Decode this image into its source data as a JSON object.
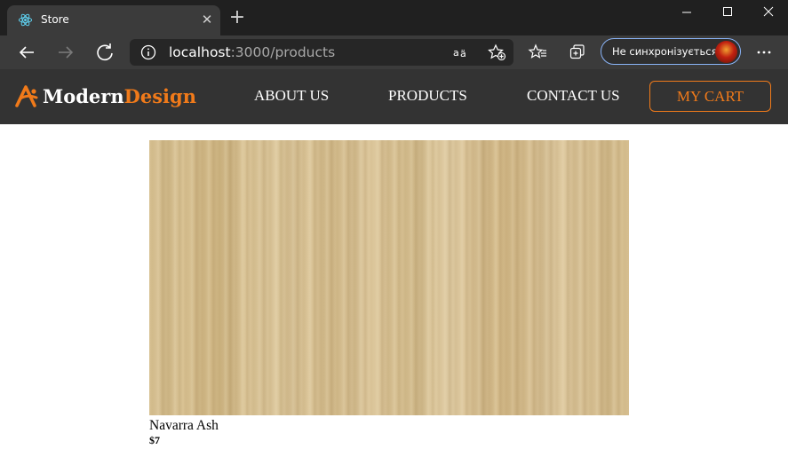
{
  "browser": {
    "tab": {
      "title": "Store",
      "icon": "react-logo-icon",
      "close_label": "✕"
    },
    "new_tab_label": "+",
    "address": {
      "host": "localhost",
      "path": ":3000/products"
    },
    "sync_label": "Не синхронізується",
    "colors": {
      "titlebar": "#202020",
      "toolbar": "#3b3b3b",
      "omnibox": "#262626",
      "sync_border": "#8ab4f8"
    }
  },
  "site": {
    "brand": {
      "part1": "Modern",
      "part2": "Design",
      "icon": "brand-a-logo-icon"
    },
    "nav": {
      "about": "ABOUT US",
      "products": "PRODUCTS",
      "contact": "CONTACT US"
    },
    "cart_label": "MY CART",
    "colors": {
      "header_bg": "#333333",
      "accent": "#f07a1a"
    }
  },
  "product": {
    "name": "Navarra Ash",
    "price": "$7",
    "image_alt": "wood-texture"
  }
}
